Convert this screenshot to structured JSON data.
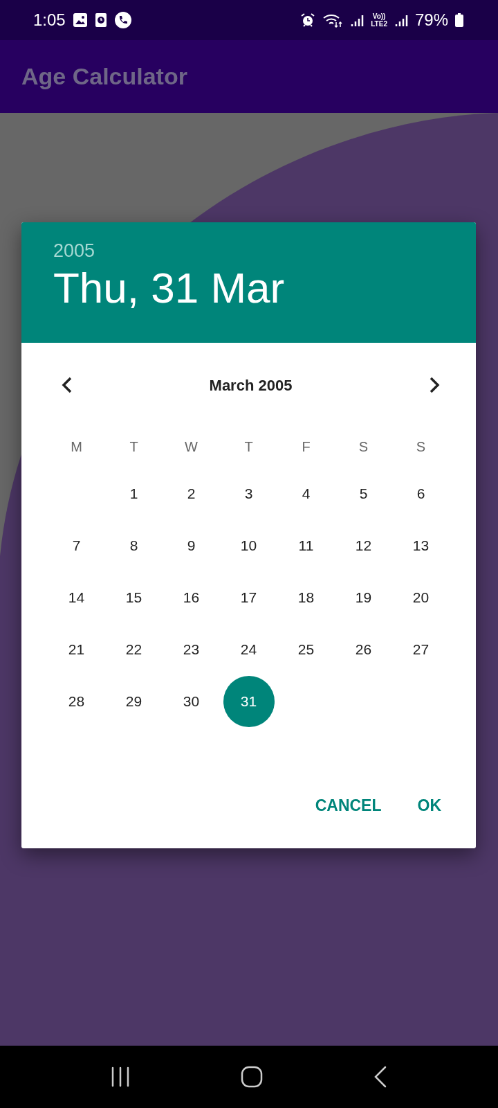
{
  "status_bar": {
    "time": "1:05",
    "network": "Vo))\nLTE2",
    "battery": "79%"
  },
  "app_bar": {
    "title": "Age Calculator"
  },
  "dialog": {
    "year": "2005",
    "date": "Thu, 31 Mar",
    "month": "March 2005",
    "weekdays": [
      "M",
      "T",
      "W",
      "T",
      "F",
      "S",
      "S"
    ],
    "days": [
      {
        "kind": "blank"
      },
      {
        "kind": "day",
        "label": "1",
        "selected": false
      },
      {
        "kind": "day",
        "label": "2",
        "selected": false
      },
      {
        "kind": "day",
        "label": "3",
        "selected": false
      },
      {
        "kind": "day",
        "label": "4",
        "selected": false
      },
      {
        "kind": "day",
        "label": "5",
        "selected": false
      },
      {
        "kind": "day",
        "label": "6",
        "selected": false
      },
      {
        "kind": "day",
        "label": "7",
        "selected": false
      },
      {
        "kind": "day",
        "label": "8",
        "selected": false
      },
      {
        "kind": "day",
        "label": "9",
        "selected": false
      },
      {
        "kind": "day",
        "label": "10",
        "selected": false
      },
      {
        "kind": "day",
        "label": "11",
        "selected": false
      },
      {
        "kind": "day",
        "label": "12",
        "selected": false
      },
      {
        "kind": "day",
        "label": "13",
        "selected": false
      },
      {
        "kind": "day",
        "label": "14",
        "selected": false
      },
      {
        "kind": "day",
        "label": "15",
        "selected": false
      },
      {
        "kind": "day",
        "label": "16",
        "selected": false
      },
      {
        "kind": "day",
        "label": "17",
        "selected": false
      },
      {
        "kind": "day",
        "label": "18",
        "selected": false
      },
      {
        "kind": "day",
        "label": "19",
        "selected": false
      },
      {
        "kind": "day",
        "label": "20",
        "selected": false
      },
      {
        "kind": "day",
        "label": "21",
        "selected": false
      },
      {
        "kind": "day",
        "label": "22",
        "selected": false
      },
      {
        "kind": "day",
        "label": "23",
        "selected": false
      },
      {
        "kind": "day",
        "label": "24",
        "selected": false
      },
      {
        "kind": "day",
        "label": "25",
        "selected": false
      },
      {
        "kind": "day",
        "label": "26",
        "selected": false
      },
      {
        "kind": "day",
        "label": "27",
        "selected": false
      },
      {
        "kind": "day",
        "label": "28",
        "selected": false
      },
      {
        "kind": "day",
        "label": "29",
        "selected": false
      },
      {
        "kind": "day",
        "label": "30",
        "selected": false
      },
      {
        "kind": "day",
        "label": "31",
        "selected": true
      }
    ],
    "buttons": [
      "CANCEL",
      "OK"
    ]
  }
}
